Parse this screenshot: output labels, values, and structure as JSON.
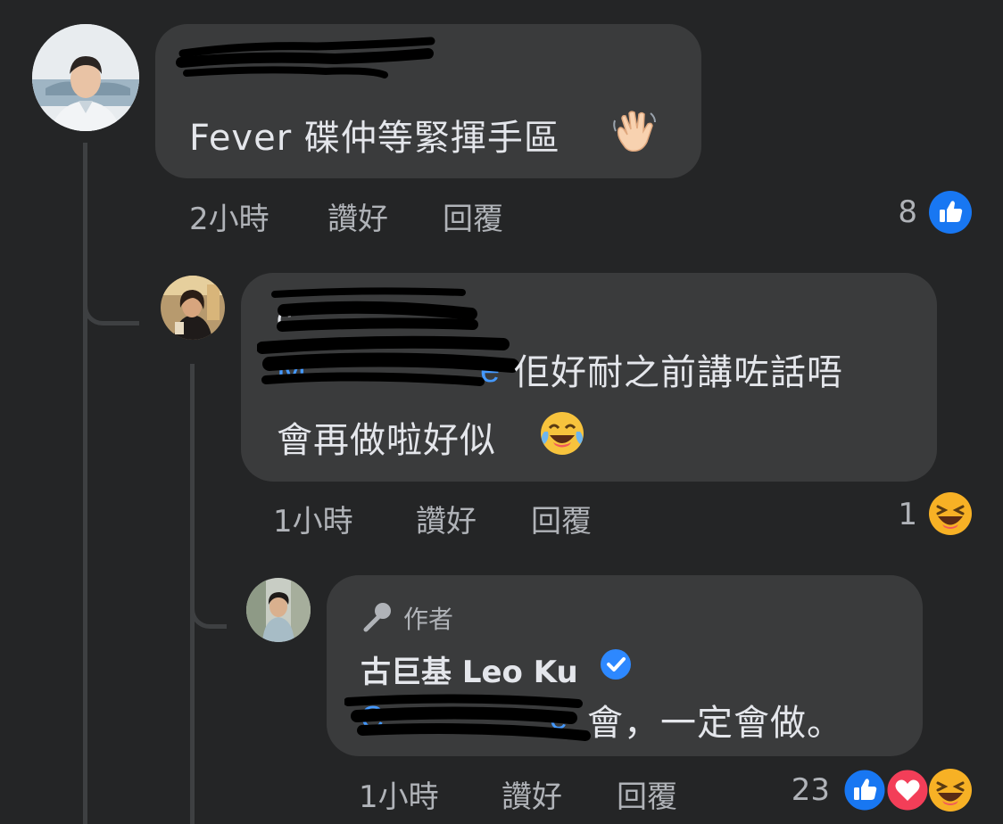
{
  "comments": [
    {
      "text": "Fever 碟仲等緊揮手區",
      "emoji": "waving-hand",
      "time": "2小時",
      "like_label": "讚好",
      "reply_label": "回覆",
      "reaction_count": "8",
      "reactions": [
        "like"
      ]
    },
    {
      "text_line1": "佢好耐之前講咗話唔",
      "text_line2": "會再做啦好似",
      "emoji": "tears-of-joy",
      "time": "1小時",
      "like_label": "讚好",
      "reply_label": "回覆",
      "reaction_count": "1",
      "reactions": [
        "haha"
      ]
    },
    {
      "author_badge": "作者",
      "author_name": "古巨基 Leo Ku",
      "verified": true,
      "text": "會，一定會做。",
      "time": "1小時",
      "like_label": "讚好",
      "reply_label": "回覆",
      "reaction_count": "23",
      "reactions": [
        "like",
        "love",
        "haha"
      ]
    }
  ],
  "colors": {
    "background": "#242526",
    "bubble": "#3a3b3c",
    "text": "#e4e6eb",
    "meta": "#b0b3b8",
    "like": "#1877f2",
    "love": "#f33e58",
    "haha": "#f7b125"
  }
}
